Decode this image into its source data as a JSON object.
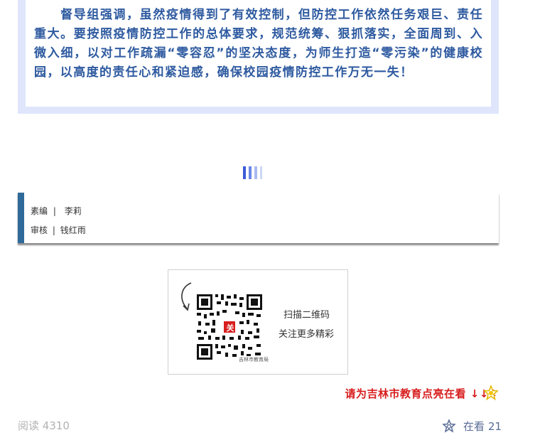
{
  "article": {
    "paragraph": "　　督导组强调，虽然疫情得到了有效控制，但防控工作依然任务艰巨、责任重大。要按照疫情防控工作的总体要求，规范统筹、狠抓落实，全面周到、入微入细，以对工作疏漏“零容忍”的坚决态度，为师生打造“零污染”的健康校园，以高度的责任心和紧迫感，确保校园疫情防控工作万无一失！"
  },
  "divider": {
    "colors": [
      "#3b5bd9",
      "#6a86e6",
      "#a9baf0",
      "#cdd7f6"
    ]
  },
  "credits": {
    "editor_label": "素编",
    "editor_sep": "|",
    "editor_name": "李莉",
    "reviewer_label": "审核",
    "reviewer_sep": "|",
    "reviewer_name": "钱红雨"
  },
  "qr_card": {
    "line1": "扫描二维码",
    "line2": "关注更多精彩",
    "badge_char": "关",
    "caption": "吉林市教育局"
  },
  "promo": {
    "text": "请为吉林市教育点亮在看",
    "arrows": "↓↓↓"
  },
  "footer": {
    "read_label": "阅读",
    "read_count": "4310",
    "watching_label": "在看",
    "watching_count": "21"
  },
  "colors": {
    "paragraph": "#2e5aa0",
    "frame": "#dfe6fb",
    "accent": "#2f6a9a",
    "promo": "#d81e1e",
    "link": "#576b95"
  }
}
